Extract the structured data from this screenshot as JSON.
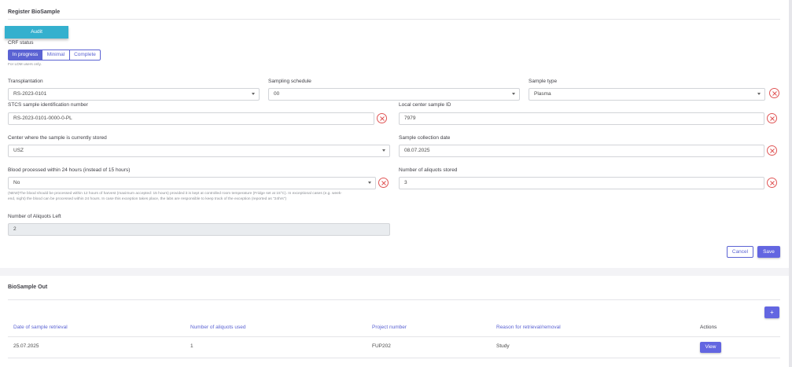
{
  "register": {
    "title": "Register BioSample",
    "audit_label": "Audit",
    "crf_status_label": "CRF status",
    "crf_options": [
      "In progress",
      "Minimal",
      "Complete"
    ],
    "crf_selected": "In progress",
    "crf_note": "For LDM users only.",
    "transplantation": {
      "label": "Transplantation",
      "value": "RS-2023-0101"
    },
    "sampling_schedule": {
      "label": "Sampling schedule",
      "value": "00"
    },
    "sample_type": {
      "label": "Sample type",
      "value": "Plasma"
    },
    "stcs_id": {
      "label": "STCS sample identification number",
      "value": "RS-2023-0101-0000-0-PL"
    },
    "local_id": {
      "label": "Local center sample ID",
      "value": "7979"
    },
    "center": {
      "label": "Center where the sample is currently stored",
      "value": "USZ"
    },
    "collection_date": {
      "label": "Sample collection date",
      "value": "08.07.2025"
    },
    "blood_processed": {
      "label": "Blood processed within 24 hours (instead of 15 hours)",
      "value": "No",
      "note_line1": "(NEW)The blood should be processed within 12 hours of harvest (maximum accepted: 15 hours) provided it is kept at controlled room temperature (Fridge set at 15°C). In exceptional cases (e.g. week-",
      "note_line2": "end, night) the blood can be processed within 24 hours. In case this exception takes place, the labs are responsible to keep track of the exception (reported as \"24hrs\")"
    },
    "aliquots_stored": {
      "label": "Number of aliquots stored",
      "value": "3"
    },
    "aliquots_left": {
      "label": "Number of Aliquots Left",
      "value": "2"
    },
    "cancel_label": "Cancel",
    "save_label": "Save"
  },
  "biosample_out": {
    "title": "BioSample Out",
    "add_label": "+",
    "columns": [
      "Date of sample retrieval",
      "Number of aliquots used",
      "Project number",
      "Reason for retrieval/removal",
      "Actions"
    ],
    "rows": [
      {
        "date": "25.07.2025",
        "aliquots": "1",
        "project": "FUP202",
        "reason": "Study",
        "action": "View"
      }
    ]
  },
  "colors": {
    "primary": "#6366e1",
    "audit": "#34b0ce",
    "clear": "#e05555",
    "header_link": "#5b63d3"
  },
  "icons": {
    "clear": "close-circle-icon",
    "dropdown": "chevron-down-icon",
    "add": "plus-icon"
  }
}
